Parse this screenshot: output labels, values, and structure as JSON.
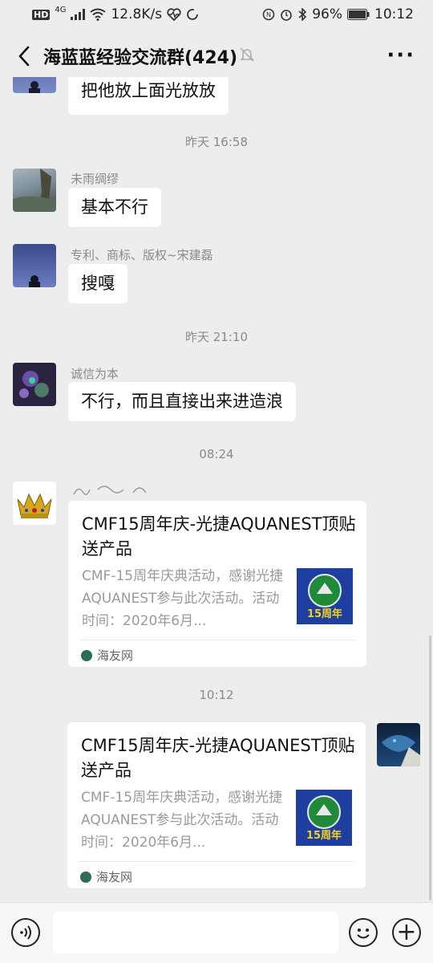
{
  "status_bar": {
    "network_badge": "HD",
    "network_type": "4G",
    "speed": "12.8K/s",
    "battery": "96%",
    "time": "10:12"
  },
  "header": {
    "title": "海蓝蓝经验交流群(424)",
    "back_icon": "chevron-left-icon",
    "mute_icon": "bell-off-icon",
    "more_icon": "more-horizontal-icon",
    "more_label": "···"
  },
  "messages": [
    {
      "type": "text",
      "sender": "",
      "text": "把他放上面光放放"
    },
    {
      "type": "time",
      "text": "昨天 16:58"
    },
    {
      "type": "text",
      "sender": "未雨绸缪",
      "text": "基本不行"
    },
    {
      "type": "text",
      "sender": "专利、商标、版权~宋建磊",
      "text": "搜嘎"
    },
    {
      "type": "time",
      "text": "昨天 21:10"
    },
    {
      "type": "text",
      "sender": "诚信为本",
      "text": "不行，而且直接出来进造浪"
    },
    {
      "type": "time",
      "text": "08:24"
    },
    {
      "type": "link_card",
      "title": "CMF15周年庆-光捷AQUANEST顶贴送产品",
      "description": "CMF-15周年庆典活动，感谢光捷AQUANEST参与此次活动。活动时间：2020年6月...",
      "source": "海友网",
      "thumb_text": "15周年"
    },
    {
      "type": "time",
      "text": "10:12"
    },
    {
      "type": "link_card",
      "title": "CMF15周年庆-光捷AQUANEST顶贴送产品",
      "description": "CMF-15周年庆典活动，感谢光捷AQUANEST参与此次活动。活动时间：2020年6月...",
      "source": "海友网",
      "thumb_text": "15周年"
    }
  ],
  "input_bar": {
    "placeholder": "",
    "voice_icon": "voice-icon",
    "emoji_icon": "emoji-icon",
    "plus_icon": "plus-icon",
    "plus_label": "+"
  },
  "colors": {
    "background": "#ededed",
    "bubble": "#ffffff",
    "meta_text": "#8a8a8a"
  }
}
